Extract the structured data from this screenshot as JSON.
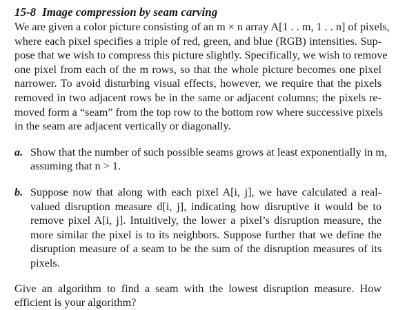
{
  "problem": {
    "number": "15-8",
    "title": "Image compression by seam carving",
    "intro_lines": [
      "We are given a color picture consisting of an m × n array A[1 . . m, 1 . . n] of pixels,",
      "where each pixel specifies a triple of red, green, and blue (RGB) intensities. Sup-",
      "pose that we wish to compress this picture slightly. Specifically, we wish to remove",
      "one pixel from each of the m rows, so that the whole picture becomes one pixel",
      "narrower. To avoid disturbing visual effects, however, we require that the pixels",
      "removed in two adjacent rows be in the same or adjacent columns; the pixels re-",
      "moved form a “seam” from the top row to the bottom row where successive pixels",
      "in the seam are adjacent vertically or diagonally."
    ],
    "parts": [
      {
        "label": "a.",
        "lines": [
          "Show that the number of such possible seams grows at least exponentially in m,",
          "assuming that n > 1."
        ]
      },
      {
        "label": "b.",
        "lines": [
          "Suppose now that along with each pixel A[i, j], we have calculated a real-",
          "valued disruption measure d[i, j], indicating how disruptive it would be to",
          "remove pixel A[i, j]. Intuitively, the lower a pixel’s disruption measure, the",
          "more similar the pixel is to its neighbors. Suppose further that we define the",
          "disruption measure of a seam to be the sum of the disruption measures of its",
          "pixels."
        ]
      }
    ],
    "closing_lines": [
      "Give an algorithm to find a seam with the lowest disruption measure. How",
      "efficient is your algorithm?"
    ]
  }
}
